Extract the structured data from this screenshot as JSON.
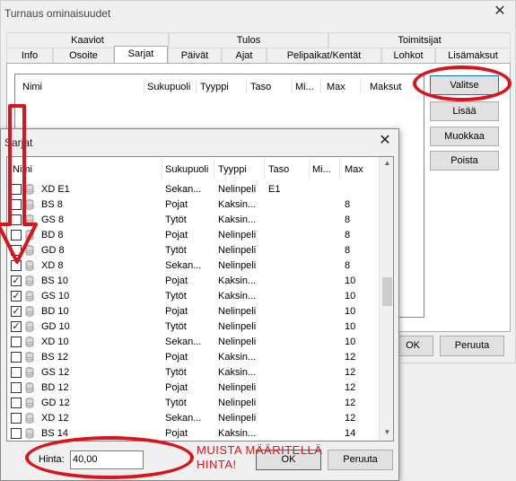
{
  "outer": {
    "title": "Turnaus ominaisuudet",
    "close": "✕",
    "group_tabs": [
      "Kaaviot",
      "Tulos",
      "Toimitsijat"
    ],
    "tabs": [
      "Info",
      "Osoite",
      "Sarjat",
      "Päivät",
      "Ajat",
      "Pelipaikat/Kentät",
      "Lohkot",
      "Lisämaksut"
    ],
    "list_headers": [
      "Nimi",
      "Sukupuoli",
      "Tyyppi",
      "Taso",
      "Mi...",
      "Max",
      "Maksut"
    ],
    "buttons": {
      "valitse": "Valitse",
      "lisaa": "Lisää",
      "muokkaa": "Muokkaa",
      "poista": "Poista",
      "ok": "OK",
      "peruuta": "Peruuta"
    }
  },
  "inner": {
    "title": "Sarjat",
    "close": "✕",
    "headers": [
      "Nimi",
      "Sukupuoli",
      "Tyyppi",
      "Taso",
      "Mi...",
      "Max"
    ],
    "rows": [
      {
        "checked": false,
        "name": "XD E1",
        "gender": "Sekan...",
        "type": "Nelinpeli",
        "level": "E1",
        "min": "",
        "max": ""
      },
      {
        "checked": false,
        "name": "BS 8",
        "gender": "Pojat",
        "type": "Kaksin...",
        "level": "",
        "min": "",
        "max": "8"
      },
      {
        "checked": false,
        "name": "GS 8",
        "gender": "Tytöt",
        "type": "Kaksin...",
        "level": "",
        "min": "",
        "max": "8"
      },
      {
        "checked": false,
        "name": "BD 8",
        "gender": "Pojat",
        "type": "Nelinpeli",
        "level": "",
        "min": "",
        "max": "8"
      },
      {
        "checked": false,
        "name": "GD 8",
        "gender": "Tytöt",
        "type": "Nelinpeli",
        "level": "",
        "min": "",
        "max": "8"
      },
      {
        "checked": false,
        "name": "XD 8",
        "gender": "Sekan...",
        "type": "Nelinpeli",
        "level": "",
        "min": "",
        "max": "8"
      },
      {
        "checked": true,
        "name": "BS 10",
        "gender": "Pojat",
        "type": "Kaksin...",
        "level": "",
        "min": "",
        "max": "10"
      },
      {
        "checked": true,
        "name": "GS 10",
        "gender": "Tytöt",
        "type": "Kaksin...",
        "level": "",
        "min": "",
        "max": "10"
      },
      {
        "checked": true,
        "name": "BD 10",
        "gender": "Pojat",
        "type": "Nelinpeli",
        "level": "",
        "min": "",
        "max": "10"
      },
      {
        "checked": true,
        "name": "GD 10",
        "gender": "Tytöt",
        "type": "Nelinpeli",
        "level": "",
        "min": "",
        "max": "10"
      },
      {
        "checked": false,
        "name": "XD 10",
        "gender": "Sekan...",
        "type": "Nelinpeli",
        "level": "",
        "min": "",
        "max": "10"
      },
      {
        "checked": false,
        "name": "BS 12",
        "gender": "Pojat",
        "type": "Kaksin...",
        "level": "",
        "min": "",
        "max": "12"
      },
      {
        "checked": false,
        "name": "GS 12",
        "gender": "Tytöt",
        "type": "Kaksin...",
        "level": "",
        "min": "",
        "max": "12"
      },
      {
        "checked": false,
        "name": "BD 12",
        "gender": "Pojat",
        "type": "Nelinpeli",
        "level": "",
        "min": "",
        "max": "12"
      },
      {
        "checked": false,
        "name": "GD 12",
        "gender": "Tytöt",
        "type": "Nelinpeli",
        "level": "",
        "min": "",
        "max": "12"
      },
      {
        "checked": false,
        "name": "XD 12",
        "gender": "Sekan...",
        "type": "Nelinpeli",
        "level": "",
        "min": "",
        "max": "12"
      },
      {
        "checked": false,
        "name": "BS 14",
        "gender": "Pojat",
        "type": "Kaksin...",
        "level": "",
        "min": "",
        "max": "14"
      }
    ],
    "hinta_label": "Hinta:",
    "hinta_value": "40,00",
    "ok": "OK",
    "peruuta": "Peruuta",
    "scroll_up": "▲",
    "scroll_down": "▼"
  },
  "annotation": {
    "text_line1": "MUISTA MÄÄRITELLÄ",
    "text_line2": "HINTA!",
    "color": "#d9141b"
  },
  "colors": {
    "accent": "#0078d7",
    "red": "#d9141b"
  }
}
